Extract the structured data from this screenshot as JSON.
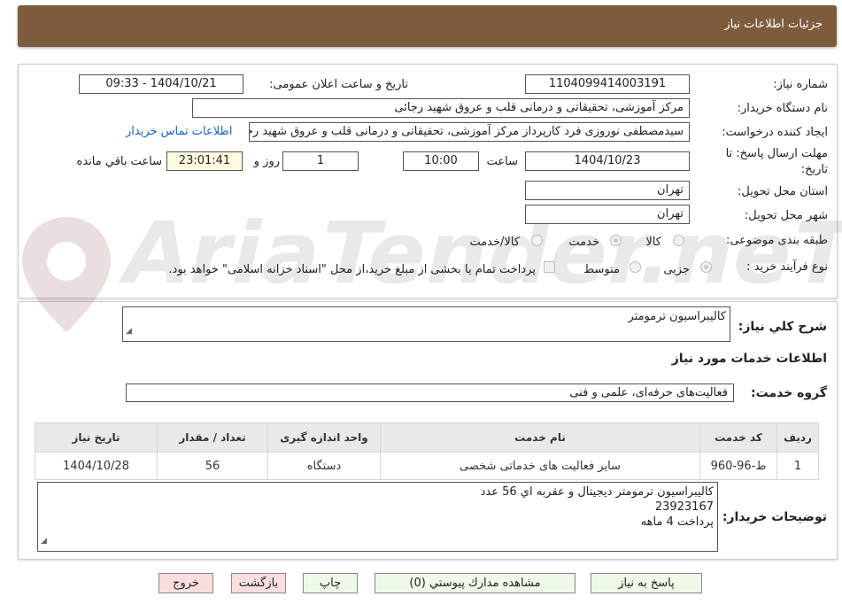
{
  "header": {
    "title": "جزئیات اطلاعات نیاز"
  },
  "form": {
    "need_number_label": "شماره نیاز:",
    "need_number": "1104099414003191",
    "announce_label": "تاریخ و ساعت اعلان عمومی:",
    "announce_value": "1404/10/21 - 09:33",
    "buyer_org_label": "نام دستگاه خریدار:",
    "buyer_org": "مرکز آموزشی، تحقیقاتی و درمانی قلب و عروق شهید رجائی",
    "creator_label": "ایجاد کننده درخواست:",
    "creator": "سیدمصطفی نوروزی فرد کارپرداز مرکز آموزشی، تحقیقاتی و درمانی قلب و عروق شهید رجائی",
    "contact_link": "اطلاعات تماس خریدار",
    "deadline_label_1": "مهلت ارسال پاسخ: تا",
    "deadline_label_2": "تاریخ:",
    "deadline_date": "1404/10/23",
    "time_label": "ساعت",
    "deadline_time": "10:00",
    "days_value": "1",
    "days_label": "روز و",
    "remaining_time": "23:01:41",
    "remaining_label": "ساعت باقي مانده",
    "province_label": "استان محل تحویل:",
    "province": "تهران",
    "city_label": "شهر محل تحویل:",
    "city": "تهران",
    "category_label": "طبقه بندی موضوعی:",
    "category_options": [
      "کالا",
      "خدمت",
      "کالا/خدمت"
    ],
    "category_selected": "خدمت",
    "process_label": "نوع فرآیند خرید :",
    "process_options": [
      "جزیی",
      "متوسط"
    ],
    "process_selected": "جزیی",
    "payment_note": "پرداخت تمام یا بخشی از مبلغ خرید،از محل \"اسناد خزانه اسلامی\" خواهد بود."
  },
  "watermark": {
    "text": "AriaTender.neT"
  },
  "summary": {
    "label": "شرح کلي نياز:",
    "value": "كاليبراسيون ترمومتر"
  },
  "services": {
    "section_title": "اطلاعات خدمات مورد نياز",
    "group_label": "گروه خدمت:",
    "group_value": "فعالیت‌های حرفه‌ای، علمی و فنی",
    "columns": [
      "رديف",
      "کد خدمت",
      "نام خدمت",
      "واحد اندازه گیری",
      "تعداد / مقدار",
      "تاريخ نياز"
    ],
    "rows": [
      {
        "row": "1",
        "code": "ط-96-960",
        "name": "سایر فعالیت های خدماتی شخصی",
        "unit": "دستگاه",
        "qty": "56",
        "date": "1404/10/28"
      }
    ]
  },
  "buyer_notes": {
    "label": "توضيحات خريدار:",
    "line1": "كاليبراسيون ترمومتر ديجيتال و عقربه اي 56 عدد",
    "line2": "23923167",
    "line3": "پرداخت 4 ماهه"
  },
  "buttons": {
    "reply": "پاسخ به نياز",
    "attachments": "مشاهده مدارك پيوستي (0)",
    "print": "چاپ",
    "back": "بازگشت",
    "exit": "خروج"
  }
}
